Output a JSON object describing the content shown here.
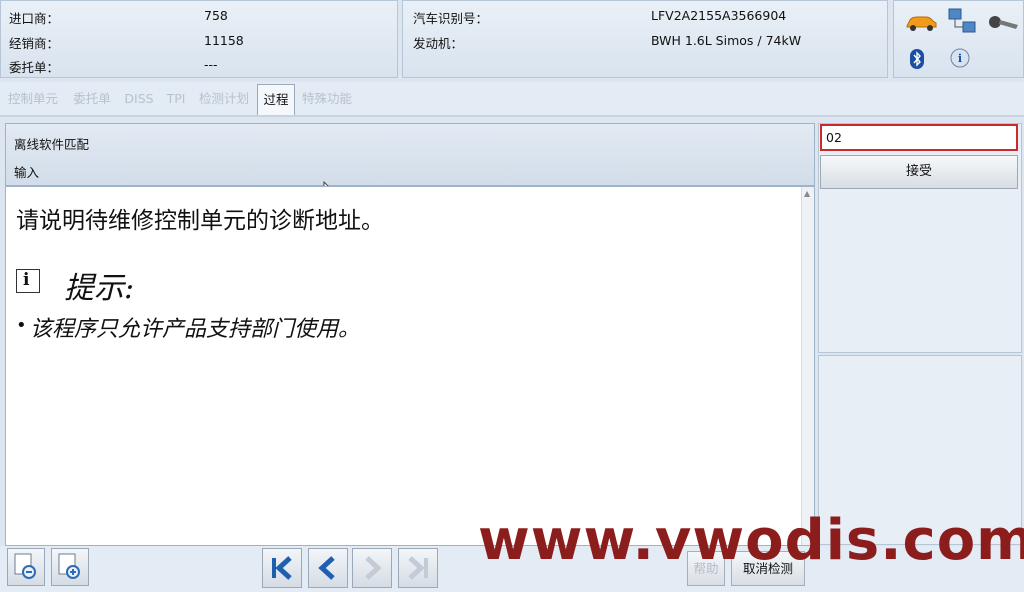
{
  "header": {
    "left": [
      {
        "label": "进口商：",
        "value": "758"
      },
      {
        "label": "经销商：",
        "value": "11158"
      },
      {
        "label": "委托单：",
        "value": "---"
      }
    ],
    "middle": [
      {
        "label": "汽车识别号：",
        "value": "LFV2A2155A3566904"
      },
      {
        "label": "发动机：",
        "value": "BWH 1.6L Simos / 74kW"
      }
    ]
  },
  "tabs": [
    "控制单元",
    "委托单",
    "DISS",
    "TPI",
    "检测计划",
    "过程",
    "特殊功能"
  ],
  "active_tab": "过程",
  "title": {
    "line1": "离线软件匹配",
    "line2": "输入"
  },
  "content": {
    "question": "请说明待维修控制单元的诊断地址。",
    "hint_title": "提示:",
    "hint_item": "该程序只允许产品支持部门使用。",
    "hint_bullet": "•"
  },
  "input": {
    "value": "02"
  },
  "accept_label": "接受",
  "bottom": {
    "help_label": "帮助",
    "cancel_label": "取消检测"
  },
  "watermark": "www.vwodis.com",
  "icons": [
    "car-icon",
    "network-icon",
    "key-icon",
    "bluetooth-icon",
    "info-icon"
  ]
}
